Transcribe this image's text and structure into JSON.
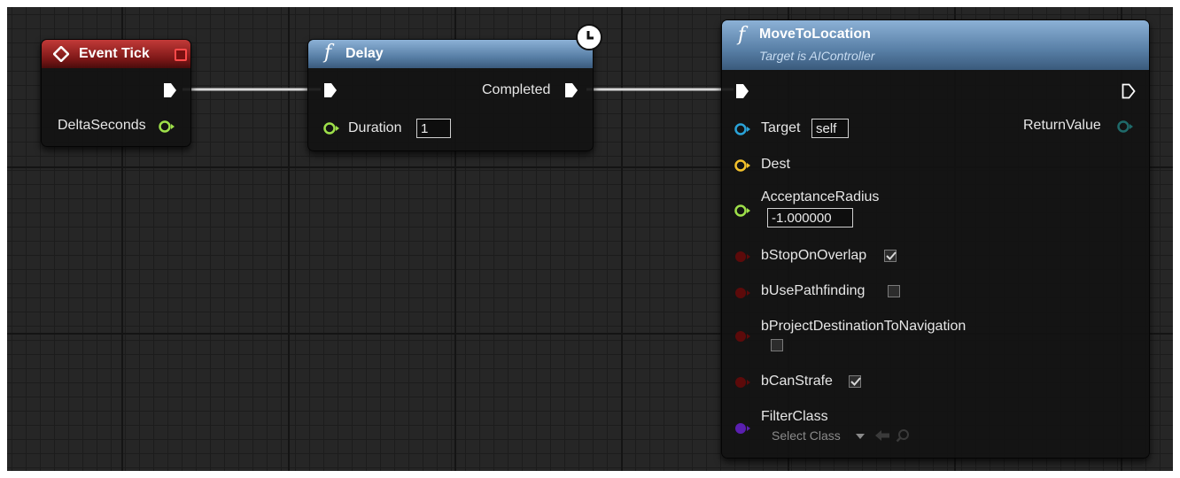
{
  "event_tick": {
    "title": "Event Tick",
    "output_label": "DeltaSeconds",
    "color": "#b42a28"
  },
  "delay": {
    "title": "Delay",
    "completed_label": "Completed",
    "duration_label": "Duration",
    "duration_value": "1",
    "latent_icon": "clock-icon"
  },
  "move_to_location": {
    "title": "MoveToLocation",
    "subtitle": "Target is AIController",
    "target_label": "Target",
    "target_value": "self",
    "return_label": "ReturnValue",
    "dest_label": "Dest",
    "acceptance_label": "AcceptanceRadius",
    "acceptance_value": "-1.000000",
    "stop_on_overlap_label": "bStopOnOverlap",
    "stop_on_overlap_checked": true,
    "use_pathfinding_label": "bUsePathfinding",
    "use_pathfinding_checked": false,
    "project_dest_label": "bProjectDestinationToNavigation",
    "project_dest_checked": false,
    "can_strafe_label": "bCanStrafe",
    "can_strafe_checked": true,
    "filter_class_label": "FilterClass",
    "filter_class_value": "Select Class"
  },
  "pin_colors": {
    "exec": "#ffffff",
    "float": "#9ee04a",
    "object": "#2aa3d8",
    "vector": "#f3c12c",
    "bool": "#8c1010",
    "class": "#5a1fb0"
  }
}
